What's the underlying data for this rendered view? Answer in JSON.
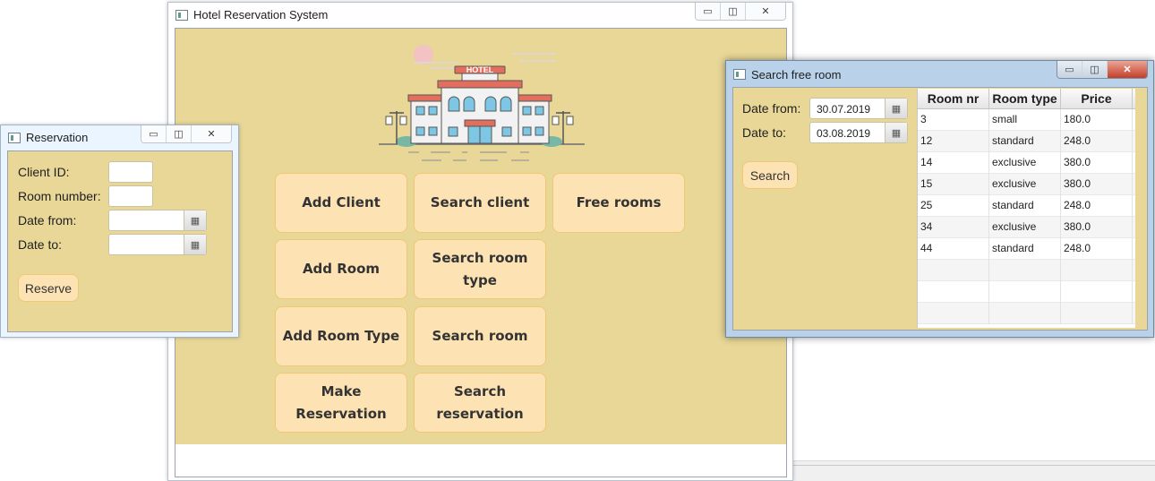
{
  "main_window": {
    "title": "Hotel Reservation System",
    "hotel_sign": "HOTEL",
    "buttons": [
      {
        "label": "Add Client"
      },
      {
        "label": "Search client"
      },
      {
        "label": "Free rooms"
      },
      {
        "label": "Add Room"
      },
      {
        "label": "Search room type"
      },
      {
        "label": "Add Room Type"
      },
      {
        "label": "Search room"
      },
      {
        "label": "Make Reservation"
      },
      {
        "label": "Search reservation"
      }
    ]
  },
  "reservation_window": {
    "title": "Reservation",
    "client_id_label": "Client ID:",
    "room_number_label": "Room number:",
    "date_from_label": "Date from:",
    "date_to_label": "Date to:",
    "client_id_value": "",
    "room_number_value": "",
    "date_from_value": "",
    "date_to_value": "",
    "reserve_button": "Reserve"
  },
  "search_window": {
    "title": "Search free room",
    "date_from_label": "Date from:",
    "date_to_label": "Date to:",
    "date_from_value": "30.07.2019",
    "date_to_value": "03.08.2019",
    "search_button": "Search",
    "columns": [
      "Room nr",
      "Room type",
      "Price"
    ],
    "rows": [
      [
        "3",
        "small",
        "180.0"
      ],
      [
        "12",
        "standard",
        "248.0"
      ],
      [
        "14",
        "exclusive",
        "380.0"
      ],
      [
        "15",
        "exclusive",
        "380.0"
      ],
      [
        "25",
        "standard",
        "248.0"
      ],
      [
        "34",
        "exclusive",
        "380.0"
      ],
      [
        "44",
        "standard",
        "248.0"
      ]
    ]
  },
  "icons": {
    "window": "app-window-icon",
    "minimize": "minimize-icon",
    "maximize": "maximize-icon",
    "close": "close-icon",
    "calendar": "calendar-icon"
  },
  "colors": {
    "panel_background": "#e8d797",
    "button_fill": "#fde3b4",
    "button_border": "#f0c872"
  }
}
